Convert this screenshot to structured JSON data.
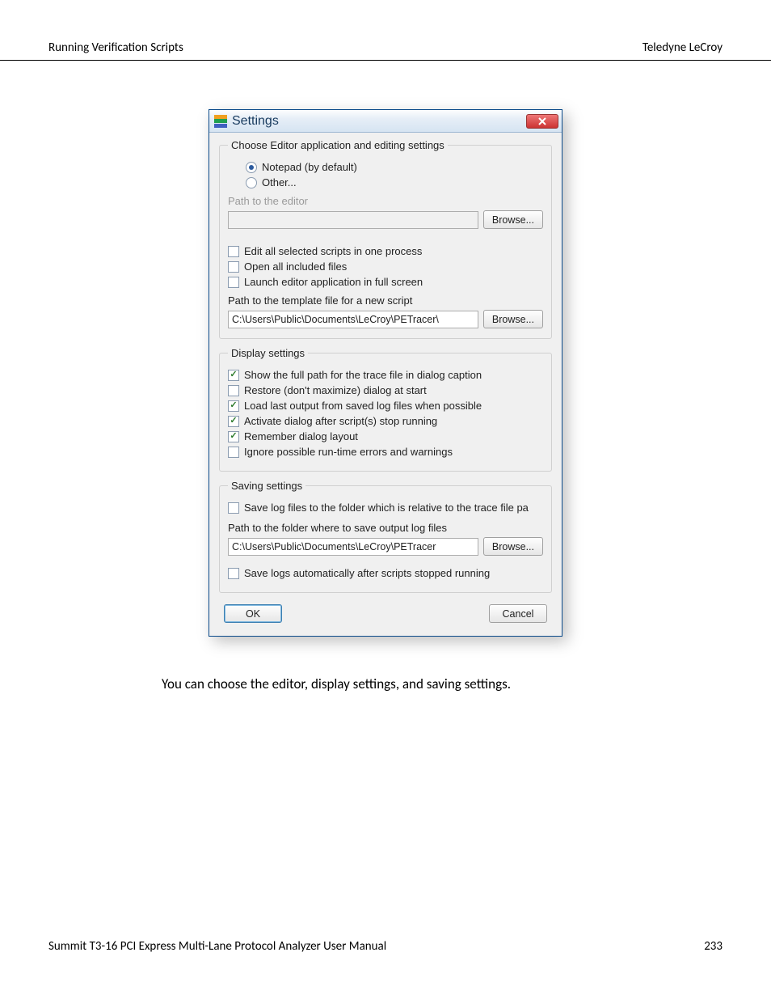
{
  "header": {
    "left": "Running Verification Scripts",
    "right": "Teledyne LeCroy"
  },
  "dialog": {
    "title": "Settings",
    "groups": {
      "editor": {
        "legend": "Choose Editor application and editing settings",
        "radio_notepad": "Notepad (by default)",
        "radio_other": "Other...",
        "path_label": "Path to the editor",
        "path_value": "",
        "browse": "Browse...",
        "chk_edit_one_process": "Edit all selected scripts in one process",
        "chk_open_included": "Open all included files",
        "chk_fullscreen": "Launch editor application in full screen",
        "template_label": "Path to the template file for a new script",
        "template_value": "C:\\Users\\Public\\Documents\\LeCroy\\PETracer\\",
        "template_browse": "Browse..."
      },
      "display": {
        "legend": "Display settings",
        "chk_full_path": "Show the full path for the trace file in dialog caption",
        "chk_restore": "Restore (don't maximize) dialog at start",
        "chk_load_output": "Load last output from saved log files when possible",
        "chk_activate": "Activate dialog after script(s) stop running",
        "chk_remember": "Remember dialog layout",
        "chk_ignore": "Ignore possible run-time errors and warnings"
      },
      "saving": {
        "legend": "Saving settings",
        "chk_save_relative": "Save log files to the folder which is relative to the trace file pa",
        "path_label": "Path to the folder where to save output log files",
        "path_value": "C:\\Users\\Public\\Documents\\LeCroy\\PETracer",
        "browse": "Browse...",
        "chk_auto_save": "Save logs automatically after scripts stopped running"
      }
    },
    "buttons": {
      "ok": "OK",
      "cancel": "Cancel"
    }
  },
  "caption": "You can choose the editor, display settings, and saving settings.",
  "footer": {
    "left": "Summit T3-16 PCI Express Multi-Lane Protocol Analyzer User Manual",
    "right": "233"
  }
}
